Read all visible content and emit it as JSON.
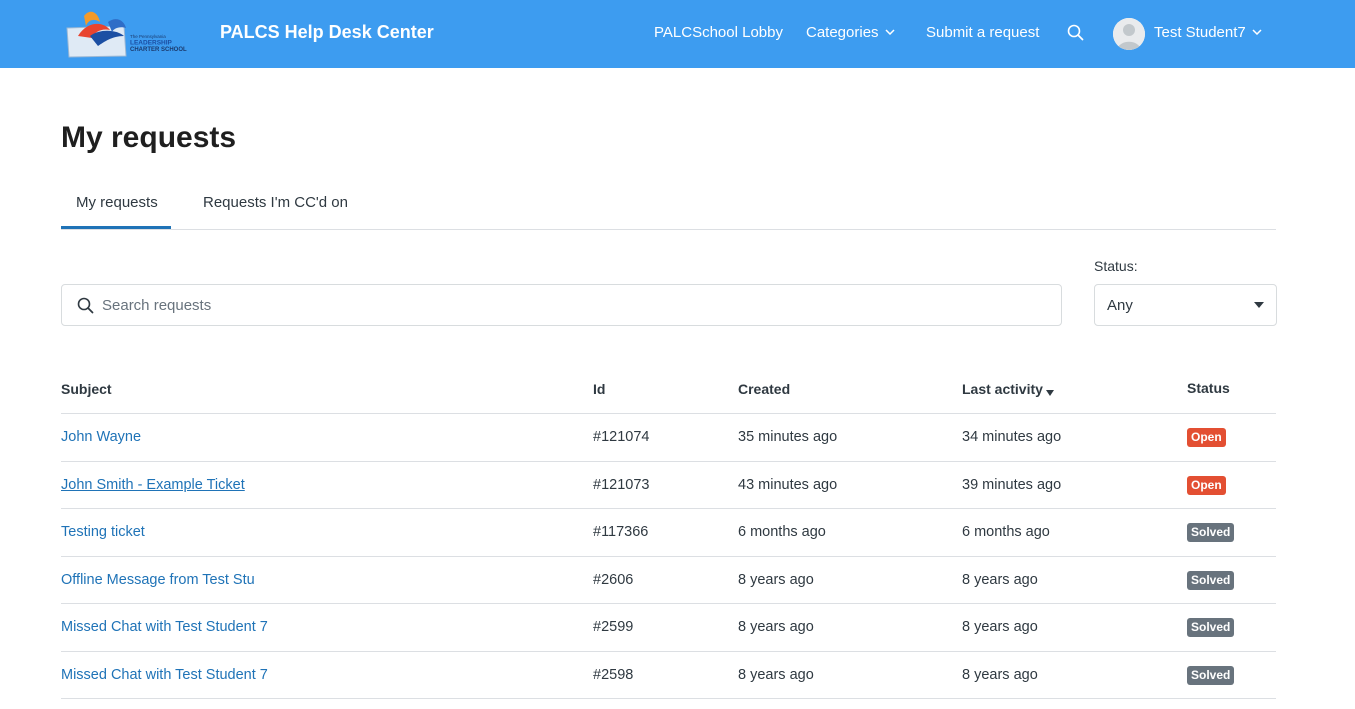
{
  "header": {
    "brand": "PALCS Help Desk Center",
    "logo_text_small": "The Pennsylvania",
    "logo_text_1": "LEADERSHIP",
    "logo_text_2": "CHARTER SCHOOL",
    "nav": {
      "lobby": "PALCSchool Lobby",
      "categories": "Categories",
      "submit": "Submit a request"
    },
    "user_name": "Test Student7",
    "colors": {
      "bar": "#3d9cf0"
    }
  },
  "page": {
    "title": "My requests",
    "tabs": [
      {
        "label": "My requests",
        "active": true
      },
      {
        "label": "Requests I'm CC'd on",
        "active": false
      }
    ]
  },
  "filters": {
    "search_placeholder": "Search requests",
    "search_value": "",
    "status_label": "Status:",
    "status_value": "Any"
  },
  "table": {
    "headers": {
      "subject": "Subject",
      "id": "Id",
      "created": "Created",
      "last_activity": "Last activity",
      "status": "Status"
    },
    "rows": [
      {
        "subject": "John Wayne",
        "id": "#121074",
        "created": "35 minutes ago",
        "last_activity": "34 minutes ago",
        "status": "Open",
        "status_color": "#e34f32"
      },
      {
        "subject": "John Smith - Example Ticket",
        "id": "#121073",
        "created": "43 minutes ago",
        "last_activity": "39 minutes ago",
        "status": "Open",
        "status_color": "#e34f32"
      },
      {
        "subject": "Testing ticket",
        "id": "#117366",
        "created": "6 months ago",
        "last_activity": "6 months ago",
        "status": "Solved",
        "status_color": "#68737d"
      },
      {
        "subject": "Offline Message from Test Stu",
        "id": "#2606",
        "created": "8 years ago",
        "last_activity": "8 years ago",
        "status": "Solved",
        "status_color": "#68737d"
      },
      {
        "subject": "Missed Chat with Test Student 7",
        "id": "#2599",
        "created": "8 years ago",
        "last_activity": "8 years ago",
        "status": "Solved",
        "status_color": "#68737d"
      },
      {
        "subject": "Missed Chat with Test Student 7",
        "id": "#2598",
        "created": "8 years ago",
        "last_activity": "8 years ago",
        "status": "Solved",
        "status_color": "#68737d"
      }
    ]
  }
}
